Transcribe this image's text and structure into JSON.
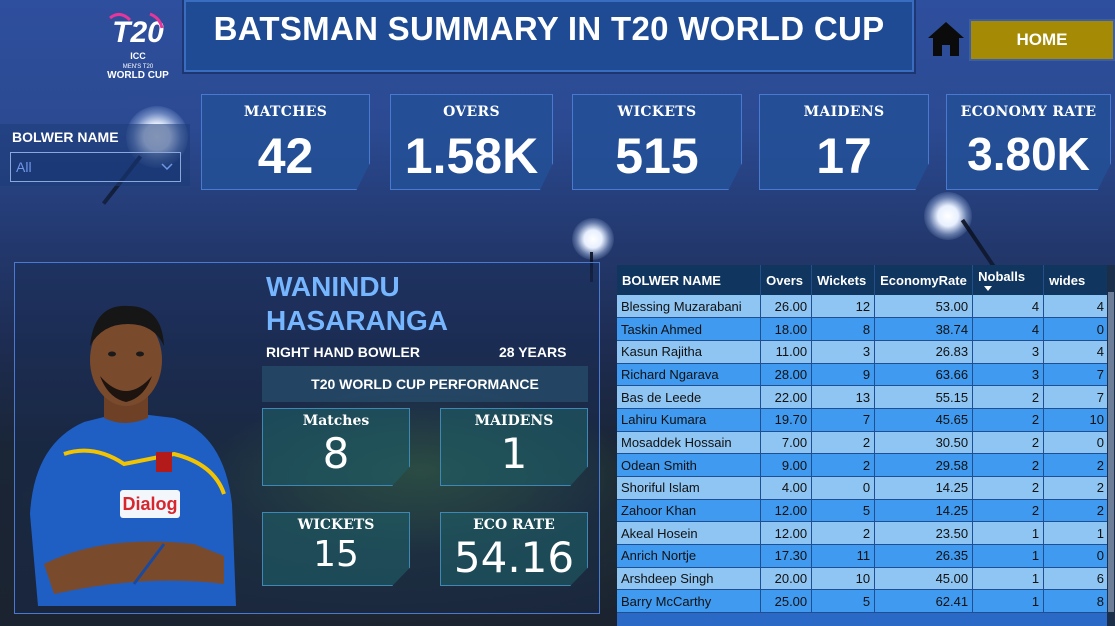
{
  "header": {
    "logo": {
      "line1": "ICC",
      "line2": "MEN'S T20",
      "line3": "WORLD CUP",
      "mark": "T20"
    },
    "title": "BATSMAN SUMMARY IN T20 WORLD CUP",
    "home_icon": "home-icon",
    "home_label": "HOME"
  },
  "slicer": {
    "label": "BOLWER NAME",
    "value": "All"
  },
  "kpis": [
    {
      "label": "MATCHES",
      "value": "42"
    },
    {
      "label": "OVERS",
      "value": "1.58K"
    },
    {
      "label": "WICKETS",
      "value": "515"
    },
    {
      "label": "MAIDENS",
      "value": "17"
    },
    {
      "label": "ECONOMY RATE",
      "value": "3.80K"
    }
  ],
  "player": {
    "first_name": "WANINDU",
    "last_name": "HASARANGA",
    "role": "RIGHT HAND BOWLER",
    "age": "28 YEARS",
    "performance_title": "T20 WORLD CUP PERFORMANCE",
    "stats": {
      "matches_label": "Matches",
      "matches": "8",
      "maidens_label": "MAIDENS",
      "maidens": "1",
      "wickets_label": "WICKETS",
      "wickets": "15",
      "eco_label": "ECO RATE",
      "eco": "54.16"
    },
    "jersey_text": "Dialog"
  },
  "table": {
    "columns": [
      "BOLWER NAME",
      "Overs",
      "Wickets",
      "EconomyRate",
      "Noballs",
      "wides"
    ],
    "rows": [
      [
        "Blessing Muzarabani",
        "26.00",
        "12",
        "53.00",
        "4",
        "4"
      ],
      [
        "Taskin Ahmed",
        "18.00",
        "8",
        "38.74",
        "4",
        "0"
      ],
      [
        "Kasun Rajitha",
        "11.00",
        "3",
        "26.83",
        "3",
        "4"
      ],
      [
        "Richard Ngarava",
        "28.00",
        "9",
        "63.66",
        "3",
        "7"
      ],
      [
        "Bas de Leede",
        "22.00",
        "13",
        "55.15",
        "2",
        "7"
      ],
      [
        "Lahiru Kumara",
        "19.70",
        "7",
        "45.65",
        "2",
        "10"
      ],
      [
        "Mosaddek Hossain",
        "7.00",
        "2",
        "30.50",
        "2",
        "0"
      ],
      [
        "Odean Smith",
        "9.00",
        "2",
        "29.58",
        "2",
        "2"
      ],
      [
        "Shoriful Islam",
        "4.00",
        "0",
        "14.25",
        "2",
        "2"
      ],
      [
        "Zahoor Khan",
        "12.00",
        "5",
        "14.25",
        "2",
        "2"
      ],
      [
        "Akeal Hosein",
        "12.00",
        "2",
        "23.50",
        "1",
        "1"
      ],
      [
        "Anrich Nortje",
        "17.30",
        "11",
        "26.35",
        "1",
        "0"
      ],
      [
        "Arshdeep Singh",
        "20.00",
        "10",
        "45.00",
        "1",
        "6"
      ],
      [
        "Barry McCarthy",
        "25.00",
        "5",
        "62.41",
        "1",
        "8"
      ]
    ]
  },
  "colors": {
    "title_bg": "#1e4b93",
    "home_bg": "#a48a05",
    "player_name": "#76b6ff",
    "row_light": "#8ec5f3",
    "row_dark": "#3f9af0",
    "table_header": "#10355f"
  }
}
